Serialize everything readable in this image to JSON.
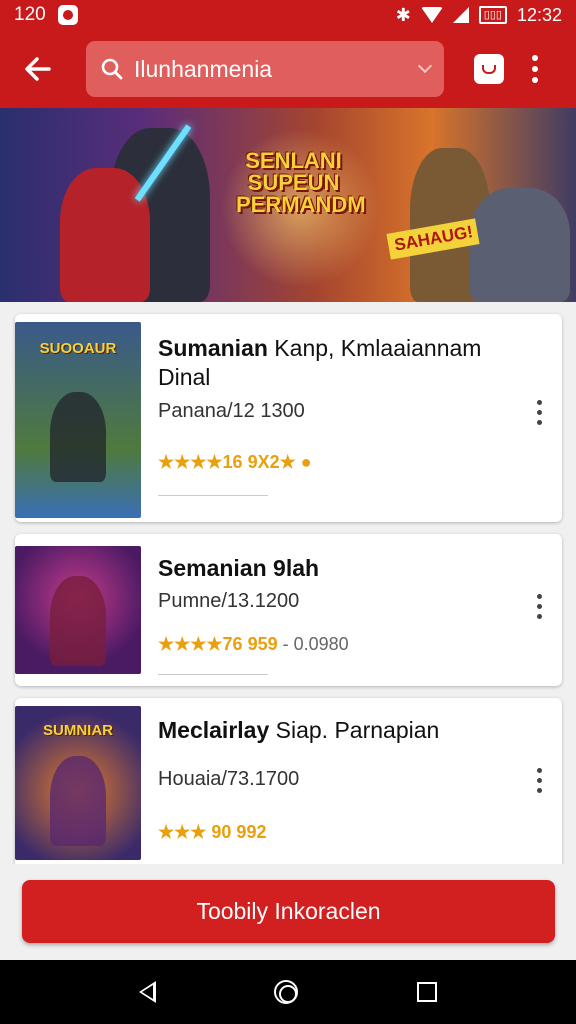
{
  "status_bar": {
    "time_left": "120",
    "time_right": "12:32",
    "battery": "▯▯▯"
  },
  "app_bar": {
    "search_text": "Ilunhanmenia"
  },
  "banner": {
    "title": "SENLANI SUPEUN PERMANDM",
    "tag": "SAHAUG!"
  },
  "items": [
    {
      "title_bold": "Sumanian",
      "title_rest": " Kanp, Kmlaaiannam Dinal",
      "meta": "Panana/12 1300",
      "rating": "★★★★16 9X2★ ●",
      "thumb_label": "SUOOAUR"
    },
    {
      "title_bold": "Semanian 9lah",
      "title_rest": "",
      "meta": "Pumne/13.1200",
      "rating": "★★★★76 959",
      "rating_extra": " - 0.0980",
      "thumb_label": ""
    },
    {
      "title_bold": "Meclairlay",
      "title_rest": " Siap. Parnapian",
      "meta": "Houaia/73.1700",
      "rating": "★★★ 90 992",
      "thumb_label": "SUMNIAR"
    }
  ],
  "cta": {
    "label": "Toobily Inkoraclen"
  }
}
